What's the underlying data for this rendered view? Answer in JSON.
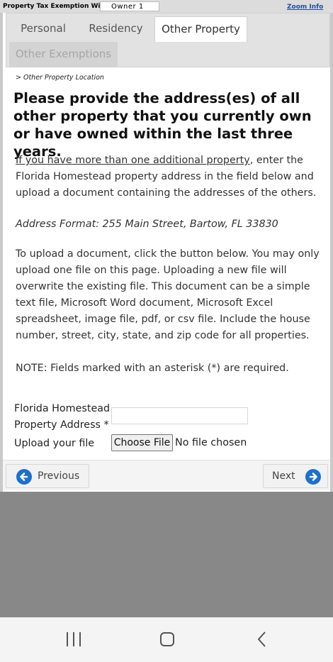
{
  "header": {
    "wizard_title": "Property Tax Exemption Wizard -",
    "owner": "Owner 1",
    "zoom_link": "Zoom Info"
  },
  "tabs": [
    {
      "label": "Personal"
    },
    {
      "label": "Residency"
    },
    {
      "label": "Other Property"
    },
    {
      "label": "Other Exemptions"
    }
  ],
  "breadcrumb": ">  Other Property Location",
  "heading": "Please provide the address(es) of all other property that you currently own or have owned within the last three years.",
  "instructions": {
    "p1_link": "If you have more than one additional property",
    "p1_rest": ", enter the Florida Homestead property address in the field below and upload a document containing the addresses of the others.",
    "p2": "Address Format: 255 Main Street, Bartow, FL 33830",
    "p3": "To upload a document, click the button below. You may only upload one file on this page. Uploading a new file will overwrite the existing file. This document can be a simple text file, Microsoft Word document, Microsoft Excel spreadsheet, image file, pdf, or csv file. Include the house number, street, city, state, and zip code for all properties.",
    "p4": "NOTE: Fields marked with an asterisk (*) are required."
  },
  "form": {
    "address_label": "Florida Homestead Property Address *",
    "address_value": "",
    "upload_label": "Upload your file",
    "choose_file_label": "Choose File",
    "file_status": "No file chosen"
  },
  "footer": {
    "previous_label": "Previous",
    "next_label": "Next"
  },
  "colors": {
    "accent": "#1d6fd2",
    "link": "#1e4f9c",
    "page_background": "#888888"
  }
}
